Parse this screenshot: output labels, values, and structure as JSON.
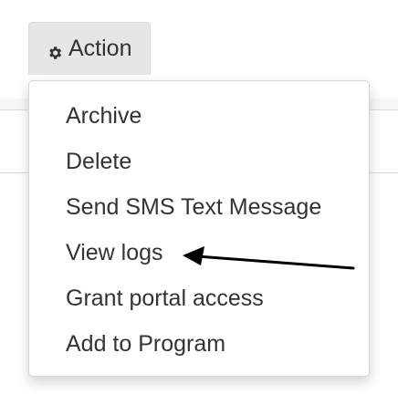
{
  "action_button": {
    "label": "Action",
    "icon": "gear-icon"
  },
  "menu": {
    "items": [
      {
        "label": "Archive"
      },
      {
        "label": "Delete"
      },
      {
        "label": "Send SMS Text Message"
      },
      {
        "label": "View logs"
      },
      {
        "label": "Grant portal access"
      },
      {
        "label": "Add to Program"
      }
    ]
  },
  "annotation": {
    "type": "arrow",
    "points_to": "View logs",
    "color": "#000000"
  },
  "colors": {
    "button_bg": "#e6e6e6",
    "text": "#333333",
    "menu_border": "#d6d6d6"
  }
}
